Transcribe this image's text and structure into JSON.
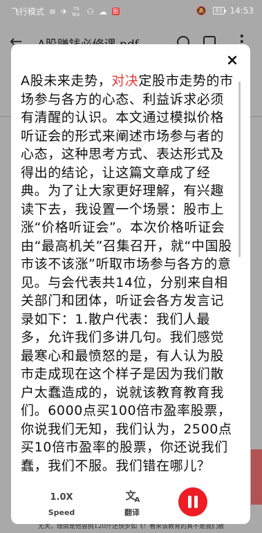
{
  "status_bar": {
    "airplane_mode_label": "飞行模式",
    "speed_top": "73",
    "speed_bottom": "B/s",
    "notification_badge": "图",
    "battery": "83",
    "time": "14:53"
  },
  "background_app": {
    "title": "A股赚钱必修课.pdf",
    "footer_text": "无关，理由是他曾挑120斤还快步如飞！看来该教育的真不是我们散"
  },
  "dialog": {
    "close_label": "×",
    "content_before": "A股未来走势，",
    "content_highlight": "对决",
    "content_after": "定股市走势的市场参与各方的心态、利益诉求必须有清醒的认识。本文通过模拟价格听证会的形式来阐述市场参与者的心态，这种思考方式、表达形式及得出的结论，让这篇文章成了经典。为了让大家更好理解，有兴趣读下去，我设置一个场景：股市上涨“价格听证会”。本次价格听证会由“最高机关”召集召开，就“中国股市该不该涨”听取市场参与各方的意见。与会代表共14位，分别来自相关部门和团体，听证会各方发言记录如下：1.散户代表：我们人最多，允许我们多讲几句。我们感觉最寒心和最愤怒的是，有人认为股市走成现在这个样子是因为我们散户太蠢造成的，说就该教育教育我们。6000点买100倍市盈率股票，你说我们无知，我们认为，2500点买10倍市盈率的股票，你还说我们蠢，我们不服。我们错在哪儿？",
    "controls": {
      "speed_value": "1.0X",
      "speed_label": "Speed",
      "translate_label": "翻译"
    }
  },
  "colors": {
    "highlight": "#e53935",
    "pause_button": "#ee1c24"
  }
}
